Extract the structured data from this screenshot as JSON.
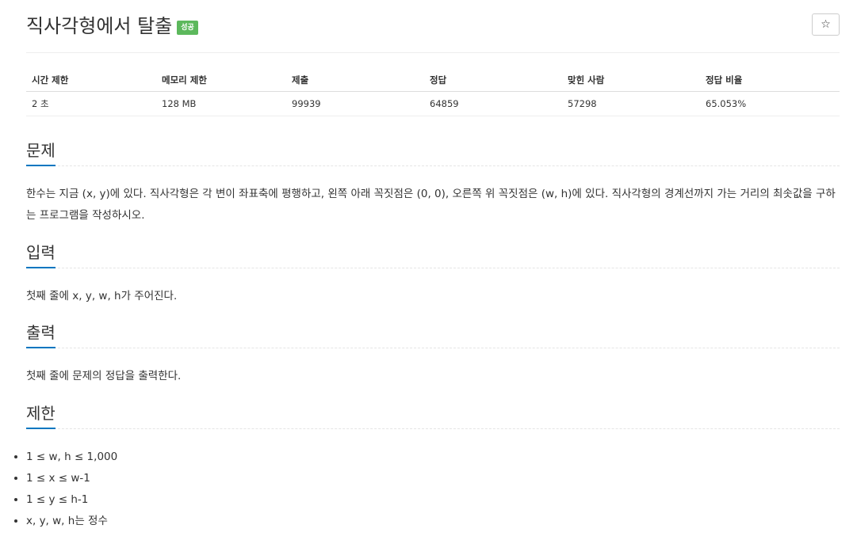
{
  "problem": {
    "title": "직사각형에서 탈출",
    "status_badge": "성공",
    "star_icon": "☆"
  },
  "info_table": {
    "headers": [
      "시간 제한",
      "메모리 제한",
      "제출",
      "정답",
      "맞힌 사람",
      "정답 비율"
    ],
    "values": [
      "2 초",
      "128 MB",
      "99939",
      "64859",
      "57298",
      "65.053%"
    ]
  },
  "sections": {
    "description": {
      "title": "문제",
      "text": "한수는 지금 (x, y)에 있다. 직사각형은 각 변이 좌표축에 평행하고, 왼쪽 아래 꼭짓점은 (0, 0), 오른쪽 위 꼭짓점은 (w, h)에 있다. 직사각형의 경계선까지 가는 거리의 최솟값을 구하는 프로그램을 작성하시오."
    },
    "input": {
      "title": "입력",
      "text": "첫째 줄에 x, y, w, h가 주어진다."
    },
    "output": {
      "title": "출력",
      "text": "첫째 줄에 문제의 정답을 출력한다."
    },
    "limits": {
      "title": "제한",
      "items": [
        "1 ≤ w, h ≤ 1,000",
        "1 ≤ x ≤ w-1",
        "1 ≤ y ≤ h-1",
        "x, y, w, h는 정수"
      ]
    }
  },
  "colors": {
    "badge_success": "#5cb85c",
    "section_underline": "#0076c0"
  }
}
